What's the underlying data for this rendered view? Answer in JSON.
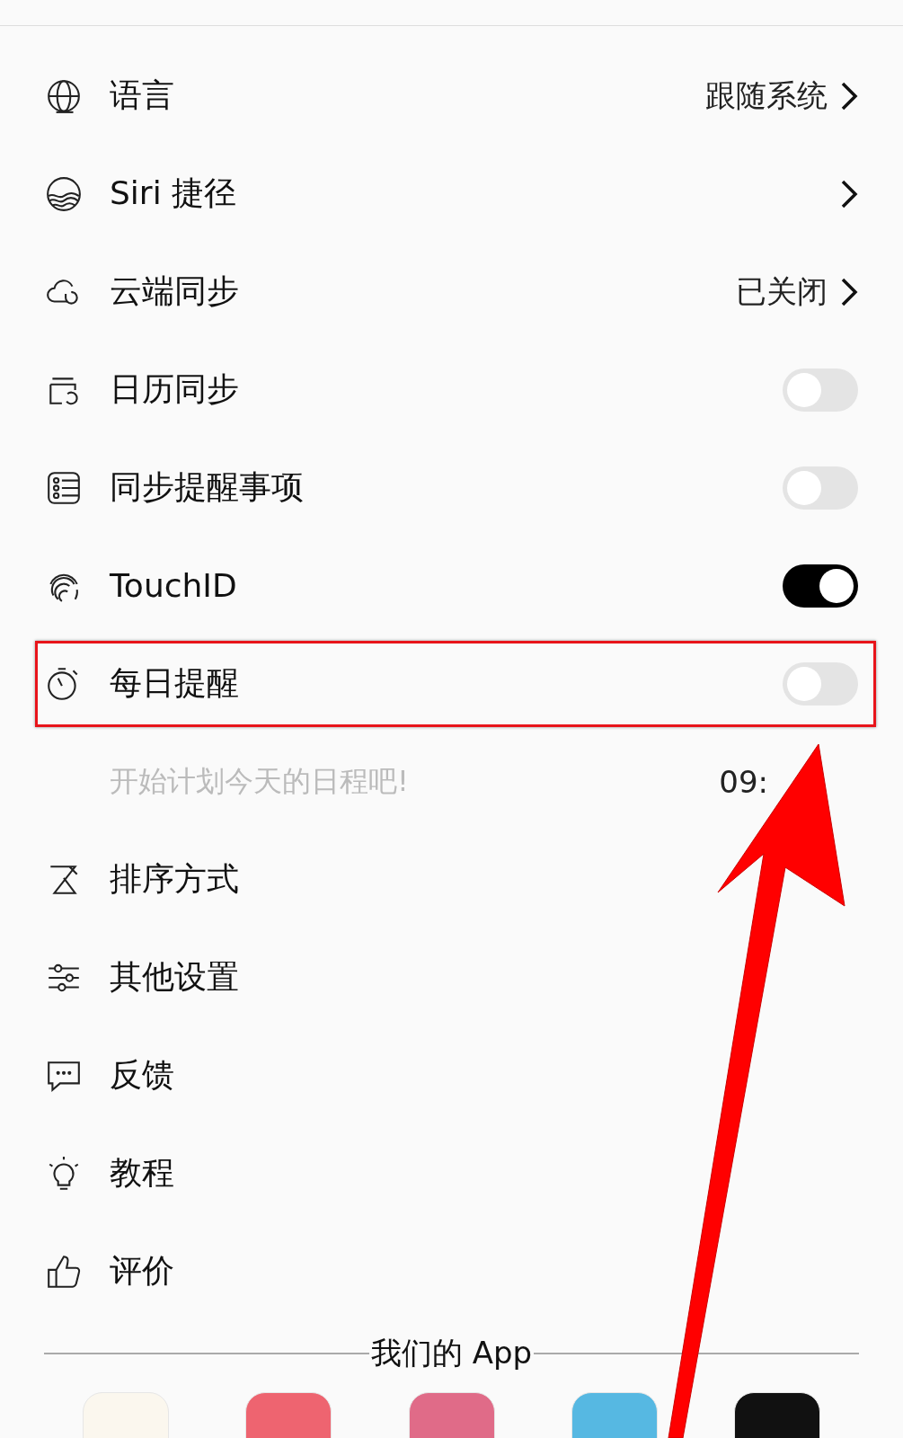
{
  "settings": [
    {
      "kind": "link",
      "label": "语言",
      "value": "跟随系统",
      "chevron": true
    },
    {
      "kind": "link",
      "label": "Siri 捷径",
      "chevron": true
    },
    {
      "kind": "link",
      "label": "云端同步",
      "value": "已关闭",
      "chevron": true
    },
    {
      "kind": "toggle",
      "label": "日历同步",
      "on": false
    },
    {
      "kind": "toggle",
      "label": "同步提醒事项",
      "on": false
    },
    {
      "kind": "toggle",
      "label": "TouchID",
      "on": true
    },
    {
      "kind": "toggle",
      "label": "每日提醒",
      "on": false,
      "highlighted": true
    },
    {
      "kind": "sub",
      "label": "开始计划今天的日程吧!",
      "value": "09:"
    },
    {
      "kind": "link",
      "label": "排序方式"
    },
    {
      "kind": "link",
      "label": "其他设置"
    },
    {
      "kind": "link",
      "label": "反馈"
    },
    {
      "kind": "link",
      "label": "教程"
    },
    {
      "kind": "link",
      "label": "评价"
    }
  ],
  "apps_section": {
    "title": "我们的 App",
    "apps": [
      {
        "color": "#fbf7ee"
      },
      {
        "color": "#ee6470"
      },
      {
        "color": "#e06b88"
      },
      {
        "color": "#56b8e2"
      },
      {
        "color": "#111111"
      }
    ]
  }
}
